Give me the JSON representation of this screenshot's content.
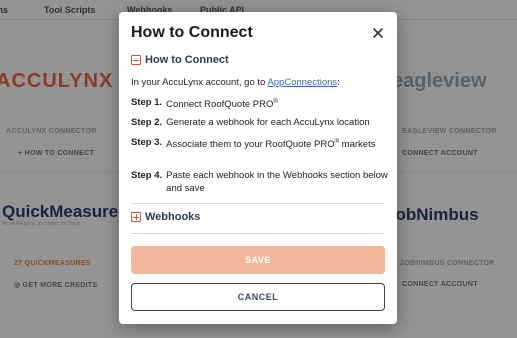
{
  "background": {
    "tabs": [
      "Tool Scripts",
      "Webhooks",
      "Public API"
    ],
    "cards": [
      {
        "logo": "ACCULYNX",
        "subtitle": "ACCULYNX CONNECTOR",
        "action": "HOW TO CONNECT"
      },
      {
        "logo": "eagleview",
        "subtitle": "EAGLEVIEW CONNECTOR",
        "action": "CONNECT ACCOUNT"
      },
      {
        "logo": "QuickMeasure",
        "tagline": "Roof Reports in Under an Hour",
        "subtitle": "27 QUICKMEASURES",
        "action": "GET MORE CREDITS"
      },
      {
        "logo": "JobNimbus",
        "subtitle": "JOBNIMBUS CONNECTOR",
        "action": "CONNECT ACCOUNT"
      }
    ]
  },
  "modal": {
    "title": "How to Connect",
    "section1": {
      "label": "How to Connect"
    },
    "intro_prefix": "In your AccuLynx account, go to ",
    "intro_link": "AppConnections",
    "intro_suffix": ":",
    "steps": [
      {
        "num": "Step 1.",
        "text": "Connect RoofQuote PRO",
        "sup": "®",
        "text2": ""
      },
      {
        "num": "Step 2.",
        "text": "Generate a webhook for each AccuLynx location",
        "sup": "",
        "text2": ""
      },
      {
        "num": "Step 3.",
        "text": "Associate them to your RoofQuote PRO",
        "sup": "®",
        "text2": " markets"
      },
      {
        "num": "Step 4.",
        "text": "Paste each webhook in the Webhooks section below and save",
        "sup": "",
        "text2": ""
      }
    ],
    "section2": {
      "label": "Webhooks"
    },
    "save_label": "SAVE",
    "cancel_label": "CANCEL"
  },
  "colors": {
    "accent": "#c8553a",
    "save_bg": "#f3b89b",
    "link": "#2c6fb7",
    "cancel_border": "#3b4660"
  },
  "icons": {
    "close": "close-icon",
    "collapse": "minus-box-icon",
    "expand": "plus-box-icon"
  }
}
